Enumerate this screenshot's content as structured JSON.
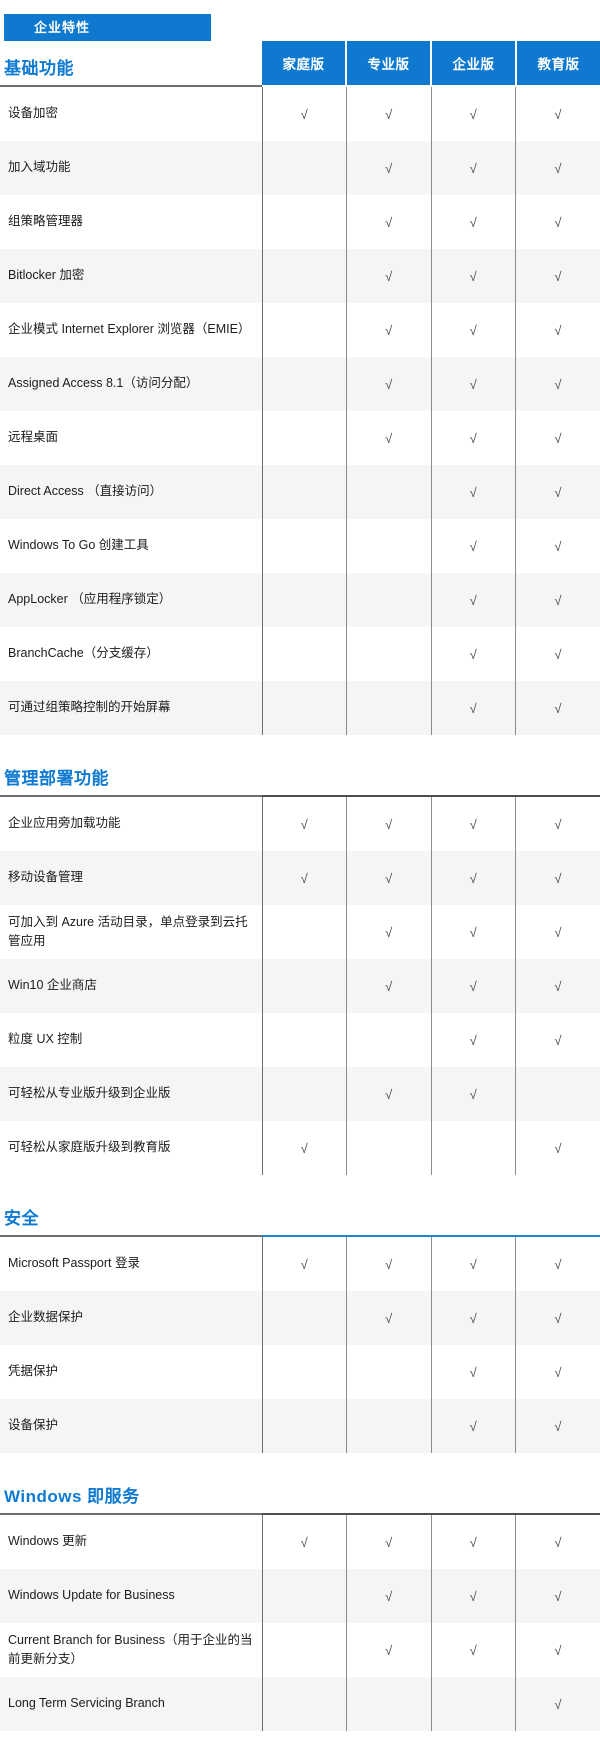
{
  "banner": {
    "label": "企业特性"
  },
  "columns": [
    "家庭版",
    "专业版",
    "企业版",
    "教育版"
  ],
  "check": "√",
  "colors": {
    "brand_blue": "#0f79d0",
    "title_blue": "#0f7ad2",
    "rule_blue": "#1b87d4",
    "row_alt": "#f5f5f5"
  },
  "sections": [
    {
      "title": "基础功能",
      "rule": "none",
      "rows": [
        {
          "label": "设备加密",
          "values": [
            "√",
            "√",
            "√",
            "√"
          ]
        },
        {
          "label": "加入域功能",
          "values": [
            "",
            "√",
            "√",
            "√"
          ]
        },
        {
          "label": "组策略管理器",
          "values": [
            "",
            "√",
            "√",
            "√"
          ]
        },
        {
          "label": "Bitlocker 加密",
          "values": [
            "",
            "√",
            "√",
            "√"
          ]
        },
        {
          "label": "企业模式 Internet Explorer 浏览器（EMIE）",
          "values": [
            "",
            "√",
            "√",
            "√"
          ]
        },
        {
          "label": "Assigned Access 8.1（访问分配）",
          "values": [
            "",
            "√",
            "√",
            "√"
          ]
        },
        {
          "label": "远程桌面",
          "values": [
            "",
            "√",
            "√",
            "√"
          ]
        },
        {
          "label": "Direct Access （直接访问）",
          "values": [
            "",
            "",
            "√",
            "√"
          ]
        },
        {
          "label": "Windows To Go 创建工具",
          "values": [
            "",
            "",
            "√",
            "√"
          ]
        },
        {
          "label": "AppLocker （应用程序锁定）",
          "values": [
            "",
            "",
            "√",
            "√"
          ]
        },
        {
          "label": "BranchCache（分支缓存）",
          "values": [
            "",
            "",
            "√",
            "√"
          ]
        },
        {
          "label": "可通过组策略控制的开始屏幕",
          "values": [
            "",
            "",
            "√",
            "√"
          ]
        }
      ]
    },
    {
      "title": "管理部署功能",
      "rule": "dark",
      "rows": [
        {
          "label": "企业应用旁加载功能",
          "values": [
            "√",
            "√",
            "√",
            "√"
          ]
        },
        {
          "label": "移动设备管理",
          "values": [
            "√",
            "√",
            "√",
            "√"
          ]
        },
        {
          "label": "可加入到 Azure 活动目录，单点登录到云托管应用",
          "values": [
            "",
            "√",
            "√",
            "√"
          ]
        },
        {
          "label": "Win10 企业商店",
          "values": [
            "",
            "√",
            "√",
            "√"
          ]
        },
        {
          "label": "粒度 UX 控制",
          "values": [
            "",
            "",
            "√",
            "√"
          ]
        },
        {
          "label": "可轻松从专业版升级到企业版",
          "values": [
            "",
            "√",
            "√",
            ""
          ]
        },
        {
          "label": "可轻松从家庭版升级到教育版",
          "values": [
            "√",
            "",
            "",
            "√"
          ]
        }
      ]
    },
    {
      "title": "安全",
      "rule": "blue",
      "rows": [
        {
          "label": "Microsoft Passport 登录",
          "values": [
            "√",
            "√",
            "√",
            "√"
          ]
        },
        {
          "label": "企业数据保护",
          "values": [
            "",
            "√",
            "√",
            "√"
          ]
        },
        {
          "label": "凭据保护",
          "values": [
            "",
            "",
            "√",
            "√"
          ]
        },
        {
          "label": "设备保护",
          "values": [
            "",
            "",
            "√",
            "√"
          ]
        }
      ]
    },
    {
      "title": "Windows 即服务",
      "rule": "dark",
      "rows": [
        {
          "label": "Windows 更新",
          "values": [
            "√",
            "√",
            "√",
            "√"
          ]
        },
        {
          "label": "Windows Update for Business",
          "values": [
            "",
            "√",
            "√",
            "√"
          ]
        },
        {
          "label": "Current Branch for Business（用于企业的当前更新分支）",
          "values": [
            "",
            "√",
            "√",
            "√"
          ]
        },
        {
          "label": "Long Term Servicing Branch",
          "values": [
            "",
            "",
            "",
            "√"
          ]
        }
      ]
    }
  ]
}
